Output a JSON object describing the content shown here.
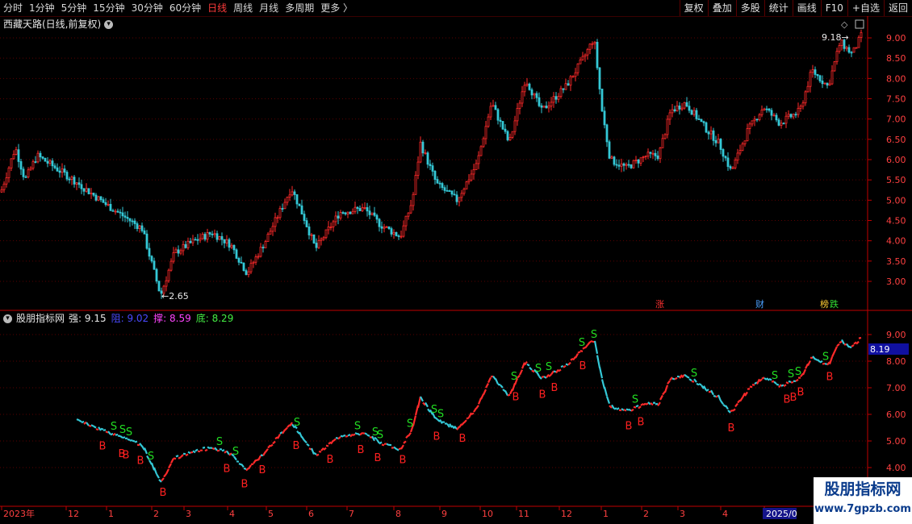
{
  "toolbar": {
    "periods": [
      "分时",
      "1分钟",
      "5分钟",
      "15分钟",
      "30分钟",
      "60分钟",
      "日线",
      "周线",
      "月线",
      "多周期",
      "更多 〉"
    ],
    "active_period": "日线",
    "buttons": [
      "复权",
      "叠加",
      "多股",
      "统计",
      "画线",
      "F10",
      "+自选",
      "返回"
    ]
  },
  "main_chart": {
    "title": "西藏天路(日线,前复权)",
    "high_label": "9.18",
    "low_label": "2.65",
    "y_ticks": [
      "9.00",
      "8.50",
      "8.00",
      "7.50",
      "7.00",
      "6.50",
      "6.00",
      "5.50",
      "5.00",
      "4.50",
      "4.00",
      "3.50",
      "3.00"
    ],
    "markers": [
      {
        "text": "涨",
        "color": "#ff3030"
      },
      {
        "text": "财",
        "color": "#4aa0ff"
      },
      {
        "text": "榜",
        "color": "#ffcc33"
      },
      {
        "text": "跌",
        "color": "#33dd33"
      }
    ]
  },
  "indicator": {
    "name": "股朋指标网",
    "fields": [
      {
        "label": "强:",
        "value": "9.15",
        "color": "#e8e8e8"
      },
      {
        "label": "阻:",
        "value": "9.02",
        "color": "#4a4aff"
      },
      {
        "label": "撑:",
        "value": "8.59",
        "color": "#ff44ff"
      },
      {
        "label": "底:",
        "value": "8.29",
        "color": "#44ee44"
      }
    ],
    "y_ticks": [
      "9.00",
      "8.00",
      "7.00",
      "6.00",
      "5.00",
      "4.00"
    ],
    "current_value": "8.19",
    "signal_buy": "B",
    "signal_sell": "S"
  },
  "time_axis": {
    "labels": [
      "2023年",
      "12",
      "1",
      "2",
      "3",
      "4",
      "5",
      "6",
      "7",
      "8",
      "9",
      "10",
      "11",
      "12",
      "1",
      "2",
      "3",
      "4",
      "2025/0"
    ]
  },
  "colors": {
    "up": "#ff2a2a",
    "down": "#34c8d6",
    "grid": "#5a0000",
    "axis": "#c00000"
  },
  "watermark": {
    "line1": "股朋指标网",
    "line2": "www.7gpzb.com"
  }
}
